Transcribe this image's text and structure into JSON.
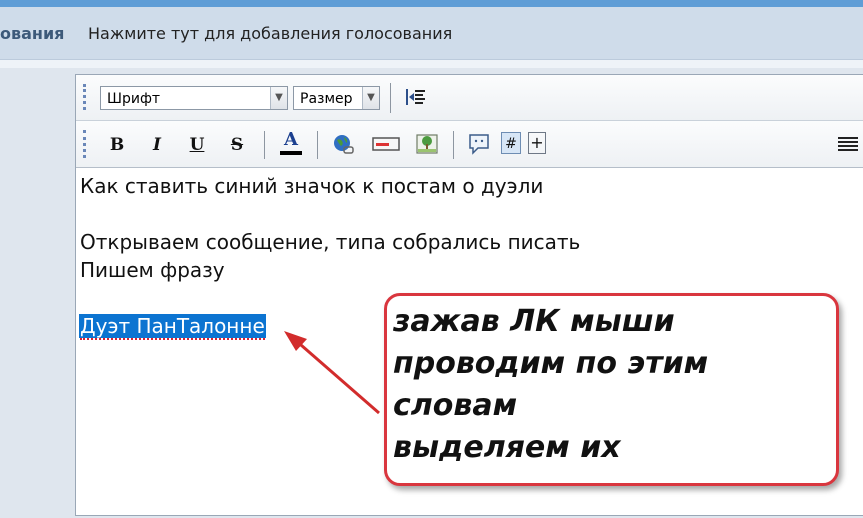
{
  "tabs": {
    "active_partial": "ования",
    "add_poll": "Нажмите тут для добавления голосования"
  },
  "toolbar": {
    "font_select": "Шрифт",
    "size_select": "Размер",
    "bold_label": "B",
    "italic_label": "I",
    "underline_label": "U",
    "strike_label": "S",
    "color_label": "A",
    "hash_label": "#",
    "plus_label": "+",
    "accent_color": "#0c74d1"
  },
  "content": {
    "line1": "Как ставить синий значок к постам о дуэли",
    "line2": "Открываем сообщение, типа собрались писать",
    "line3": "Пишем фразу",
    "selected_text": "Дуэт ПанТалонне"
  },
  "callout": {
    "line1": "зажав ЛК мыши",
    "line2": "проводим  по этим",
    "line3": "словам",
    "line4": "выделяем их",
    "border_color": "#d9363e"
  }
}
